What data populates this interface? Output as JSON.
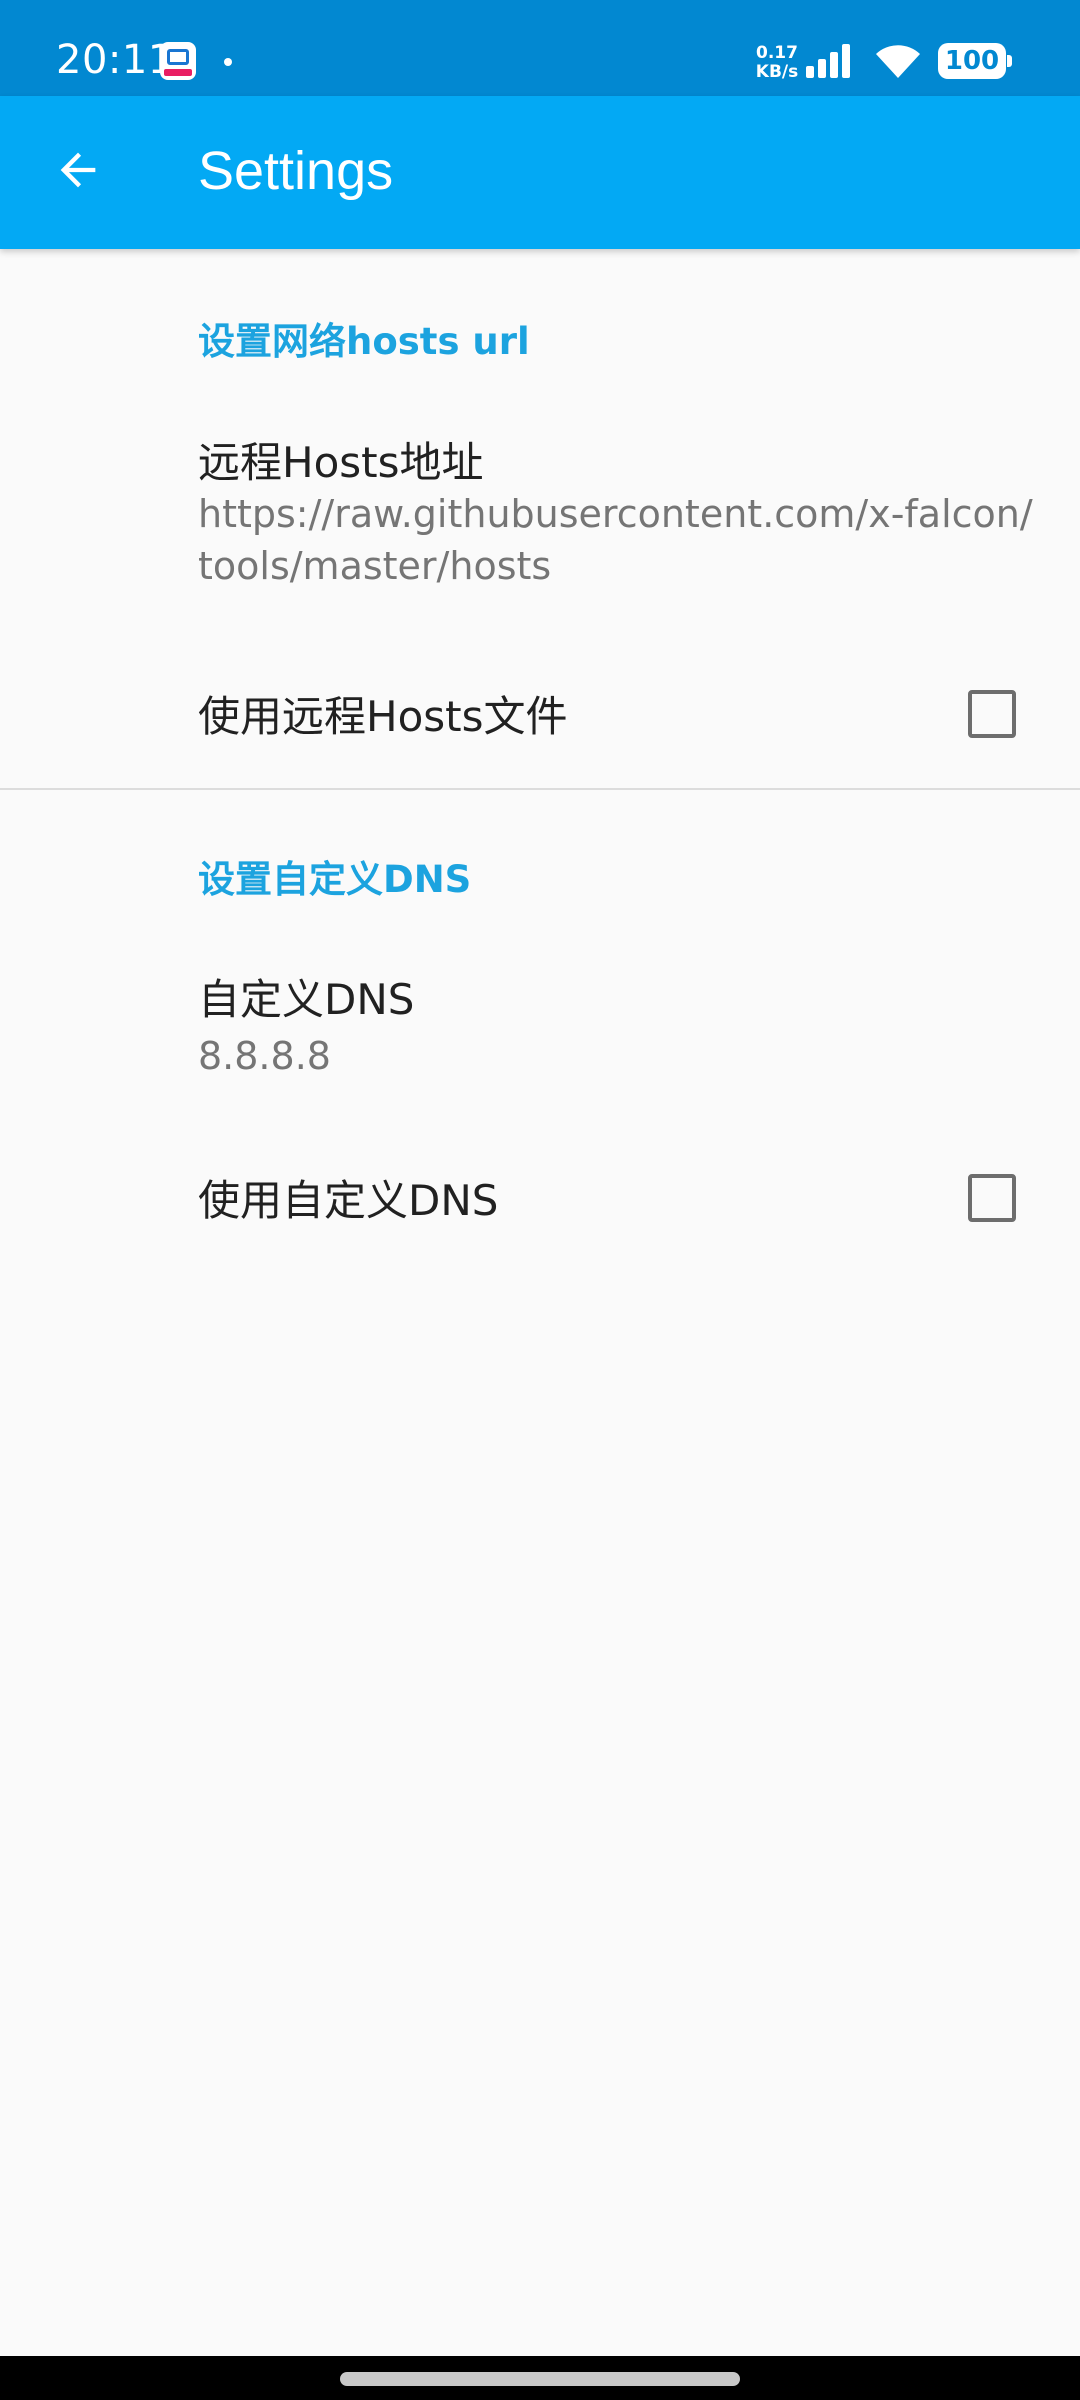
{
  "status_bar": {
    "time": "20:11",
    "net_speed_value": "0.17",
    "net_speed_unit": "KB/s",
    "battery": "100",
    "icons": [
      "app-notification-icon",
      "signal-icon",
      "wifi-icon",
      "battery-icon"
    ]
  },
  "app_bar": {
    "back_icon": "arrow-back-icon",
    "title": "Settings"
  },
  "sections": {
    "hosts": {
      "header": "设置网络hosts url",
      "remote_hosts_title": "远程Hosts地址",
      "remote_hosts_url": "https://raw.githubusercontent.com/x-falcon/tools/master/hosts",
      "use_remote_hosts_title": "使用远程Hosts文件",
      "use_remote_hosts_checked": false
    },
    "dns": {
      "header": "设置自定义DNS",
      "custom_dns_title": "自定义DNS",
      "custom_dns_value": "8.8.8.8",
      "use_custom_dns_title": "使用自定义DNS",
      "use_custom_dns_checked": false
    }
  },
  "colors": {
    "status_bar": "#0288d1",
    "app_bar": "#03a9f4",
    "accent": "#1ca3df",
    "background": "#fafafa"
  }
}
